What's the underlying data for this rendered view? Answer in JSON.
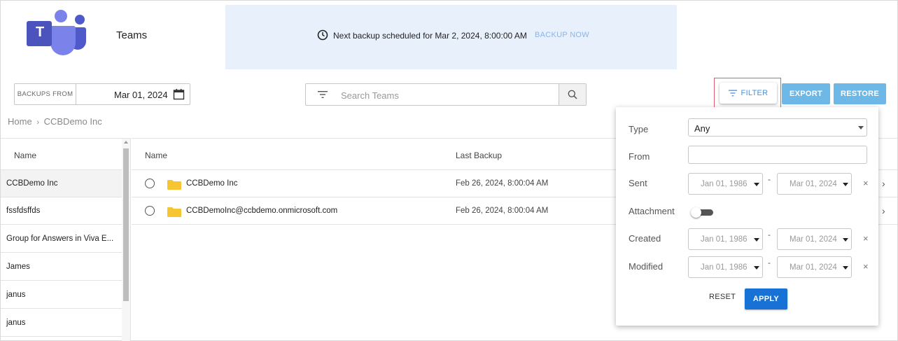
{
  "header": {
    "app_title": "Teams",
    "logo_letter": "T",
    "banner_text": "Next backup scheduled for Mar 2, 2024, 8:00:00 AM",
    "backup_now_label": "BACKUP NOW"
  },
  "toolbar": {
    "backups_from_label": "BACKUPS FROM",
    "backups_from_date": "Mar 01, 2024",
    "search_placeholder": "Search Teams",
    "filter_label": "FILTER",
    "export_label": "EXPORT",
    "restore_label": "RESTORE"
  },
  "breadcrumb": {
    "home": "Home",
    "separator": "›",
    "current": "CCBDemo Inc"
  },
  "left_list": {
    "header": "Name",
    "items": [
      "CCBDemo Inc",
      "fssfdsffds",
      "Group for Answers in Viva E...",
      "James",
      "janus",
      "janus"
    ],
    "selected": "CCBDemo Inc"
  },
  "table": {
    "columns": [
      "Name",
      "Last Backup"
    ],
    "rows": [
      {
        "name": "CCBDemo Inc",
        "last_backup": "Feb 26, 2024, 8:00:04 AM"
      },
      {
        "name": "CCBDemoInc@ccbdemo.onmicrosoft.com",
        "last_backup": "Feb 26, 2024, 8:00:04 AM"
      }
    ]
  },
  "filter_panel": {
    "type_label": "Type",
    "type_value": "Any",
    "from_label": "From",
    "from_value": "",
    "sent_label": "Sent",
    "sent_start": "Jan 01, 1986",
    "sent_end": "Mar 01, 2024",
    "attachment_label": "Attachment",
    "attachment_on": false,
    "created_label": "Created",
    "created_start": "Jan 01, 1986",
    "created_end": "Mar 01, 2024",
    "modified_label": "Modified",
    "modified_start": "Jan 01, 1986",
    "modified_end": "Mar 01, 2024",
    "range_separator": "-",
    "clear_glyph": "×",
    "reset_label": "RESET",
    "apply_label": "APPLY"
  },
  "colors": {
    "banner_bg": "#e8f0fc",
    "accent": "#4a90d9",
    "button_light_blue": "#6eb8e8",
    "apply_blue": "#1871d4",
    "folder_yellow": "#f7c531",
    "highlight_red": "#e35e6a",
    "teams_purple": "#5059c9"
  },
  "icons": {
    "clock": "clock-icon",
    "calendar": "calendar-icon",
    "filter": "filter-icon",
    "search": "search-icon",
    "folder": "folder-icon",
    "chevron": "chevron-right-icon"
  }
}
